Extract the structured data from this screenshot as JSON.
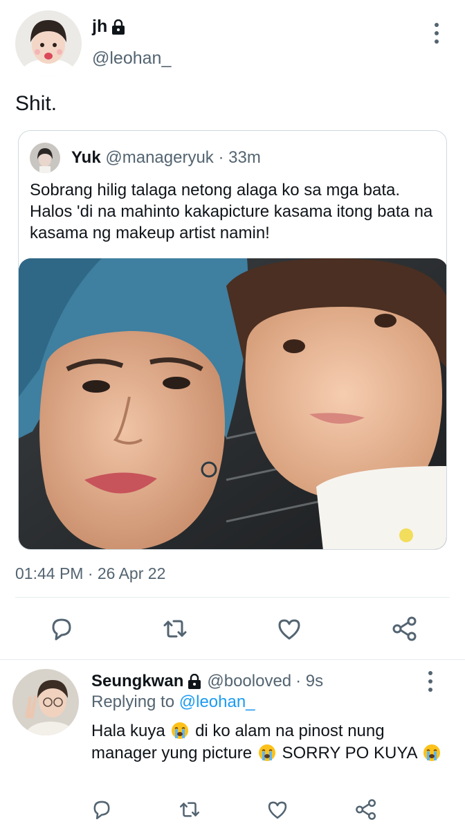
{
  "main_tweet": {
    "display_name": "jh",
    "handle": "@leohan_",
    "text": "Shit.",
    "timestamp": "01:44 PM · 26 Apr 22",
    "protected": true
  },
  "quoted_tweet": {
    "display_name": "Yuk",
    "handle": "@manageryuk",
    "age": "· 33m",
    "text": "Sobrang hilig talaga netong alaga ko sa mga bata. Halos 'di na mahinto kakapicture kasama itong bata na kasama ng makeup artist namin!"
  },
  "reply": {
    "display_name": "Seungkwan",
    "handle": "@booloved",
    "age": "· 9s",
    "replying_label": "Replying to",
    "replying_to": "@leohan_",
    "text_part1": "Hala kuya",
    "text_part2": "di ko alam na pinost nung manager yung picture",
    "text_part3": "SORRY PO KUYA",
    "protected": true
  },
  "icons": {
    "lock": "lock-icon",
    "more": "more-vertical-icon",
    "reply": "reply-icon",
    "retweet": "retweet-icon",
    "like": "heart-icon",
    "share": "share-icon",
    "emoji": "loudly-crying-face-emoji"
  },
  "colors": {
    "accent": "#1d9bf0",
    "secondary_text": "#536471",
    "border": "#cfd9de"
  }
}
